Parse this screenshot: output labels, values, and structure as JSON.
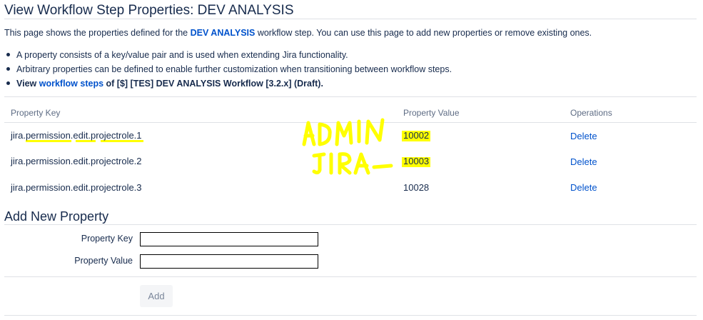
{
  "page": {
    "title": "View Workflow Step Properties: DEV ANALYSIS",
    "intro_prefix": "This page shows the properties defined for the ",
    "intro_step": "DEV ANALYSIS",
    "intro_suffix": " workflow step. You can use this page to add new properties or remove existing ones.",
    "bullets": [
      "A property consists of a key/value pair and is used when extending Jira functionality.",
      "Arbitrary properties can be defined to enable further customization when transitioning between workflow steps."
    ],
    "view_prefix": "View ",
    "view_link": "workflow steps",
    "view_suffix": " of [$] [TES] DEV ANALYSIS Workflow [3.2.x] (Draft)."
  },
  "table": {
    "headers": {
      "key": "Property Key",
      "value": "Property Value",
      "operations": "Operations"
    },
    "rows": [
      {
        "key": "jira.permission.edit.projectrole.1",
        "value": "10002",
        "action": "Delete"
      },
      {
        "key": "jira.permission.edit.projectrole.2",
        "value": "10003",
        "action": "Delete"
      },
      {
        "key": "jira.permission.edit.projectrole.3",
        "value": "10028",
        "action": "Delete"
      }
    ]
  },
  "add_form": {
    "title": "Add New Property",
    "key_label": "Property Key",
    "key_value": "",
    "value_label": "Property Value",
    "value_value": "",
    "submit_label": "Add"
  },
  "annotation": {
    "lines": [
      "ADMIN",
      "JIRA"
    ],
    "color": "#ffff00"
  },
  "colors": {
    "link": "#0052cc",
    "text": "#172b4d",
    "muted": "#5e6c84",
    "highlight": "#ffff00"
  }
}
